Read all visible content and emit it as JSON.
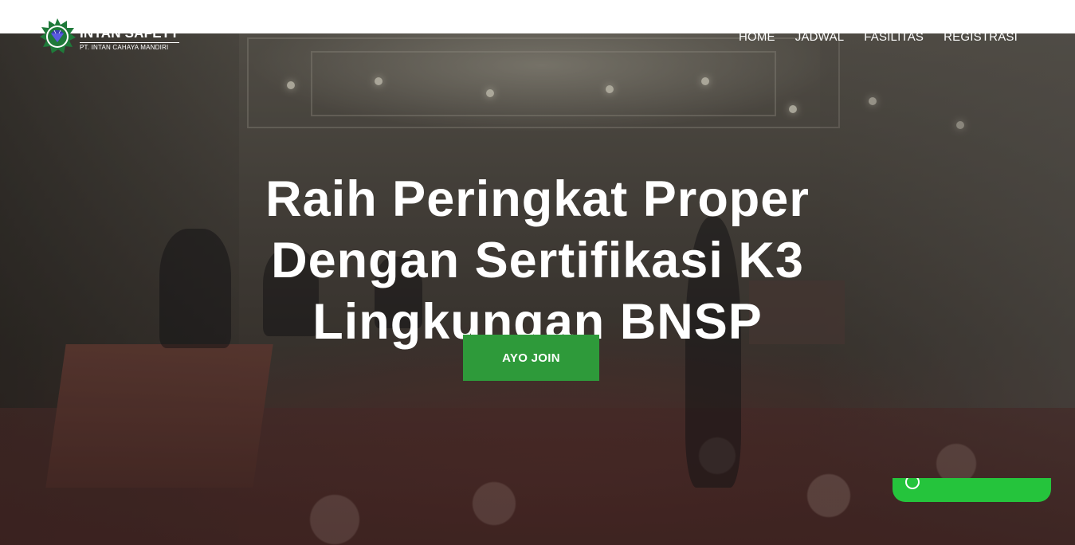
{
  "brand": {
    "name": "INTAN SAFETY",
    "subtitle": "PT. INTAN CAHAYA MANDIRI",
    "logo_icon": "diamond-star-logo"
  },
  "nav": {
    "items": [
      {
        "label": "HOME"
      },
      {
        "label": "JADWAL"
      },
      {
        "label": "FASILITAS"
      },
      {
        "label": "REGISTRASI"
      }
    ]
  },
  "hero": {
    "headline_lines": [
      "Raih Peringkat Proper",
      "Dengan Sertifikasi K3",
      "Lingkungan BNSP"
    ],
    "cta_label": "AYO JOIN"
  },
  "whatsapp": {
    "icon": "whatsapp-icon",
    "label": ""
  },
  "colors": {
    "accent": "#2e9a3a",
    "whatsapp": "#25c43c",
    "logo_green": "#1f7a3a",
    "logo_diamond": "#3b3bb5"
  }
}
